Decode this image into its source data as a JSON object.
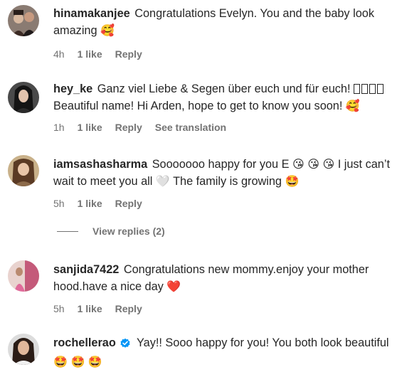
{
  "comments": [
    {
      "username": "hinamakanjee",
      "text": "Congratulations Evelyn. You and the baby look amazing",
      "emoji": "🥰",
      "time": "4h",
      "likes": "1 like",
      "reply": "Reply"
    },
    {
      "username": "hey_ke",
      "text_part1": "Ganz viel Liebe & Segen über euch und für euch!",
      "text_part2": "Beautiful name! Hi Arden, hope to get to know you soon!",
      "emoji": "🥰",
      "time": "1h",
      "likes": "1 like",
      "reply": "Reply",
      "see_translation": "See translation"
    },
    {
      "username": "iamsashasharma",
      "text_part1": "Sooooooo happy for you E",
      "emoji_kiss": "😘",
      "text_part2": "I just can’t wait to meet you all",
      "emoji_heart": "🤍",
      "text_part3": "The family is growing",
      "emoji_end": "🤩",
      "time": "5h",
      "likes": "1 like",
      "reply": "Reply"
    },
    {
      "username": "sanjida7422",
      "text": "Congratulations new mommy.enjoy your mother hood.have a nice day",
      "emoji": "❤️",
      "time": "5h",
      "likes": "1 like",
      "reply": "Reply"
    },
    {
      "username": "rochellerao",
      "text": "Yay!! Sooo happy for you! You both look beautiful",
      "emoji": "🤩",
      "verified_icon": "verified-badge-icon"
    }
  ],
  "view_replies": "View replies (2)",
  "colors": {
    "text": "#262626",
    "meta": "#737373",
    "verified": "#0095f6",
    "heart": "#e0245e"
  }
}
